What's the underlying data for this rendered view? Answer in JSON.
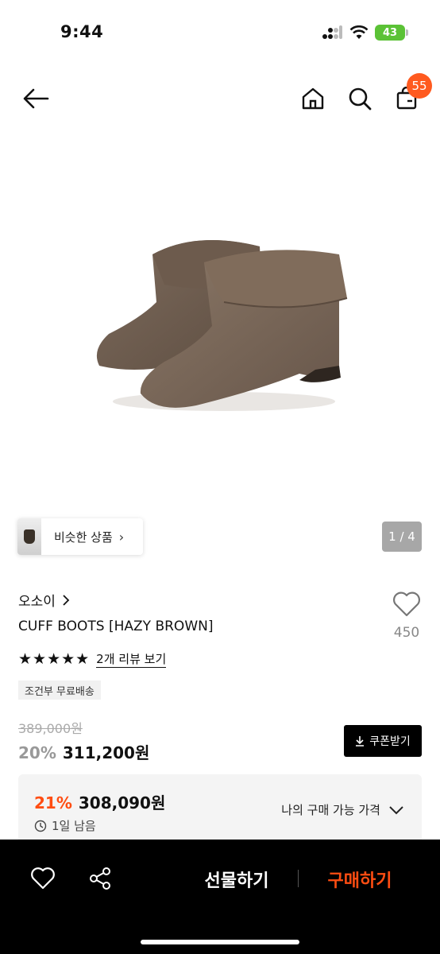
{
  "status": {
    "time": "9:44",
    "battery": "43"
  },
  "nav": {
    "cart_count": "55"
  },
  "gallery": {
    "page_indicator": "1 / 4",
    "similar_label": "비슷한 상품"
  },
  "product": {
    "brand": "오소이",
    "name": "CUFF BOOTS [HAZY BROWN]",
    "likes": "450",
    "rating_stars": "★★★★★",
    "rating_value": 5,
    "review_link": "2개 리뷰 보기",
    "shipping_badge": "조건부 무료배송",
    "original_price": "389,000원",
    "sale_percent": "20%",
    "sale_price": "311,200원",
    "coupon_label": "쿠폰받기"
  },
  "my_price": {
    "percent": "21%",
    "price": "308,090원",
    "time_left": "1일 남음",
    "toggle_label": "나의 구매 가능 가격"
  },
  "bottom_bar": {
    "gift_label": "선물하기",
    "buy_label": "구매하기"
  },
  "colors": {
    "accent": "#ff4d12",
    "badge": "#ff5a1f",
    "bar": "#000000"
  }
}
